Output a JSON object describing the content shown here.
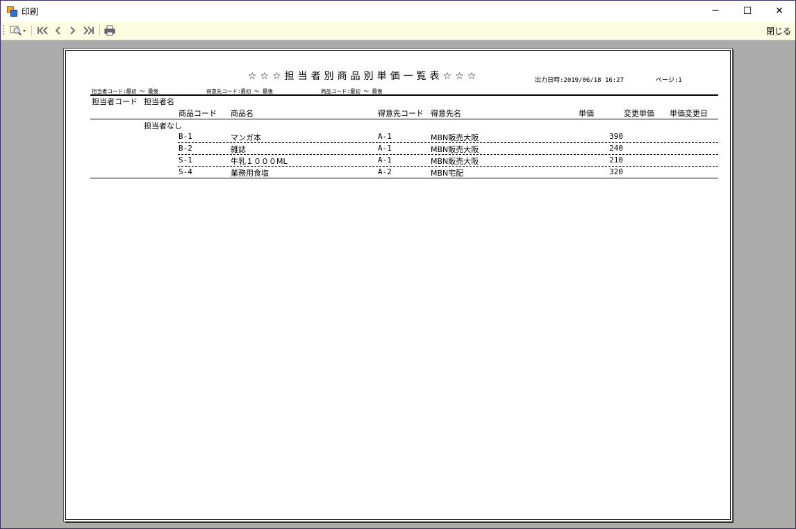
{
  "window": {
    "title": "印刷",
    "minimize": "─",
    "maximize": "☐",
    "close": "✕"
  },
  "toolbar": {
    "zoom_icon": "magnifier-icon",
    "first_page": "|<<",
    "prev_page": "<",
    "next_page": ">",
    "last_page": ">>|",
    "print_icon": "printer-icon",
    "close_label": "閉じる"
  },
  "report": {
    "title": "☆☆☆担当者別商品別単価一覧表☆☆☆",
    "output_datetime": "出力日時:2019/06/18 16:27",
    "page": "ページ:1",
    "filters": {
      "staff": "担当者コード:最初 ～ 最後",
      "customer": "得意先コード:最初 ～ 最後",
      "product": "商品コード:最初 ～ 最後"
    },
    "headers": {
      "staff_code": "担当者コード",
      "staff_name": "担当者名",
      "product_code": "商品コード",
      "product_name": "商品名",
      "customer_code": "得意先コード",
      "customer_name": "得意先名",
      "unit_price": "単価",
      "changed_price": "変更単価",
      "change_date": "単価変更日"
    },
    "group_label": "担当者なし",
    "rows": [
      {
        "product_code": "B-1",
        "product_name": "マンガ本",
        "customer_code": "A-1",
        "customer_name": "MBN販売大阪",
        "unit_price": "390"
      },
      {
        "product_code": "B-2",
        "product_name": "雑誌",
        "customer_code": "A-1",
        "customer_name": "MBN販売大阪",
        "unit_price": "240"
      },
      {
        "product_code": "S-1",
        "product_name": "牛乳１０００ML",
        "customer_code": "A-1",
        "customer_name": "MBN販売大阪",
        "unit_price": "210"
      },
      {
        "product_code": "S-4",
        "product_name": "業務用食塩",
        "customer_code": "A-2",
        "customer_name": "MBN宅配",
        "unit_price": "320"
      }
    ]
  }
}
